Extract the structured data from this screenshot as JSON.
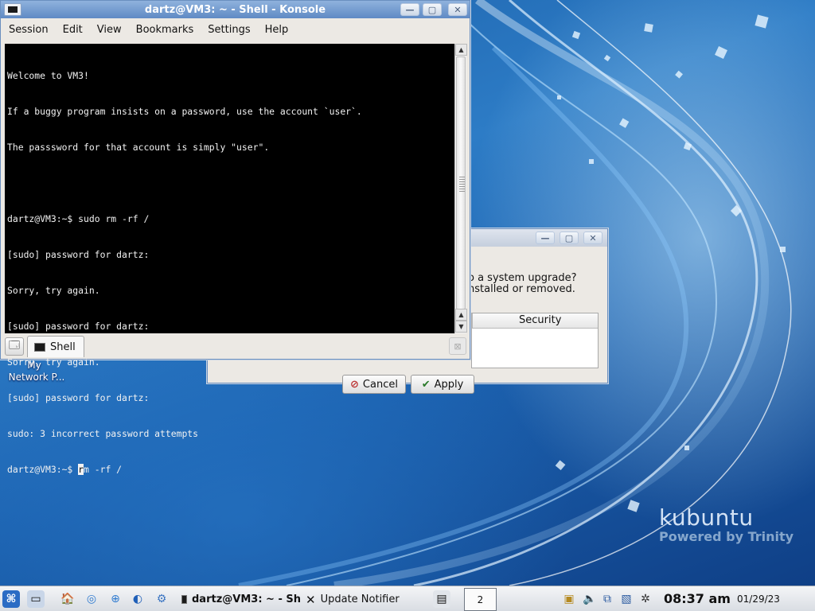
{
  "konsole": {
    "title": "dartz@VM3: ~ - Shell - Konsole",
    "menu": [
      "Session",
      "Edit",
      "View",
      "Bookmarks",
      "Settings",
      "Help"
    ],
    "lines": [
      "Welcome to VM3!",
      "If a buggy program insists on a password, use the account `user`.",
      "The passsword for that account is simply \"user\".",
      "",
      "dartz@VM3:~$ sudo rm -rf /",
      "[sudo] password for dartz:",
      "Sorry, try again.",
      "[sudo] password for dartz:",
      "Sorry, try again.",
      "[sudo] password for dartz:",
      "sudo: 3 incorrect password attempts"
    ],
    "prompt": "dartz@VM3:~$ ",
    "cursor_char": "r",
    "after_cursor": "m -rf /",
    "tab_label": "Shell"
  },
  "notifier": {
    "question_line1": "o a system upgrade?",
    "question_line2": "nstalled or removed.",
    "column_header": "Security",
    "cancel_label": "Cancel",
    "apply_label": "Apply"
  },
  "desktop": {
    "icon_label_1": "My",
    "icon_label_2": "Network P...",
    "logo_text": "kubuntu",
    "logo_subtext": "Powered by Trinity"
  },
  "taskbar": {
    "task_konsole": "dartz@VM3: ~ - Sh",
    "task_notifier": "Update Notifier",
    "pager_label": "2",
    "time": "08:37 am",
    "date": "01/29/23"
  }
}
